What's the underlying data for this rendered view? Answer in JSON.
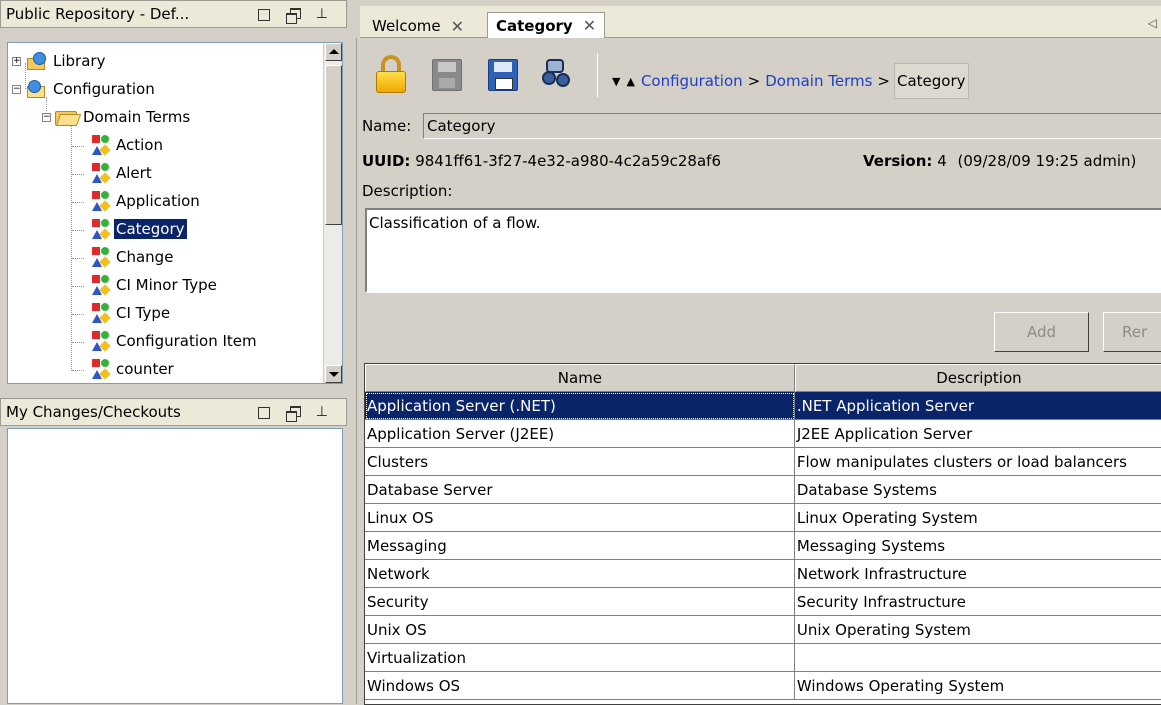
{
  "repo_pane": {
    "title": "Public Repository - Def..."
  },
  "tree": {
    "library": "Library",
    "configuration": "Configuration",
    "domain_terms": "Domain Terms",
    "items": [
      "Action",
      "Alert",
      "Application",
      "Category",
      "Change",
      "CI Minor Type",
      "CI Type",
      "Configuration Item",
      "counter"
    ],
    "selected": "Category"
  },
  "changes_pane": {
    "title": "My Changes/Checkouts"
  },
  "tabs": [
    {
      "label": "Welcome",
      "active": false
    },
    {
      "label": "Category",
      "active": true
    }
  ],
  "toolbar": {
    "icons": [
      "lock-icon",
      "save-icon-disabled",
      "save-as-icon",
      "find-icon"
    ]
  },
  "breadcrumb": {
    "path": [
      "Configuration",
      "Domain Terms"
    ],
    "separator": ">",
    "current": "Category"
  },
  "form": {
    "name_label": "Name:",
    "name_value": "Category",
    "uuid_label": "UUID:",
    "uuid_value": "9841ff61-3f27-4e32-a980-4c2a59c28af6",
    "version_label": "Version:",
    "version_value": "4",
    "version_meta": "(09/28/09 19:25 admin)",
    "description_label": "Description:",
    "description_value": "Classification of a flow."
  },
  "buttons": {
    "add": "Add",
    "remove_partial": "Rer"
  },
  "table": {
    "columns": [
      "Name",
      "Description"
    ],
    "rows": [
      [
        "Application Server (.NET)",
        ".NET Application Server"
      ],
      [
        "Application Server (J2EE)",
        "J2EE Application Server"
      ],
      [
        "Clusters",
        "Flow manipulates clusters or load balancers"
      ],
      [
        "Database Server",
        "Database Systems"
      ],
      [
        "Linux OS",
        "Linux Operating System"
      ],
      [
        "Messaging",
        "Messaging Systems"
      ],
      [
        "Network",
        "Network Infrastructure"
      ],
      [
        "Security",
        "Security Infrastructure"
      ],
      [
        "Unix OS",
        "Unix Operating System"
      ],
      [
        "Virtualization",
        ""
      ],
      [
        "Windows OS",
        "Windows Operating System"
      ]
    ],
    "selected_row": 0
  },
  "colors": {
    "selection": "#0a246a",
    "link": "#1f3fbf",
    "chrome": "#d4d0c8"
  }
}
